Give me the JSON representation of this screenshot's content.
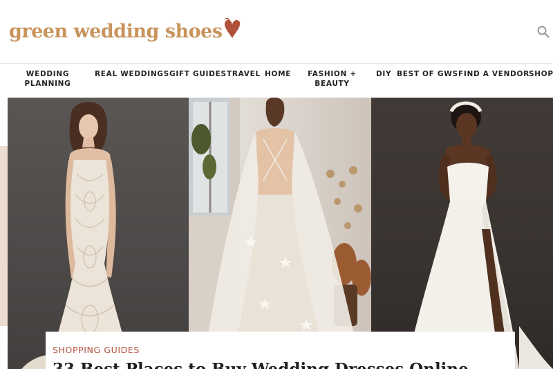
{
  "brand": {
    "logo_text": "green wedding shoes",
    "logo_color": "#c8945c",
    "heart_color": "#b1513c"
  },
  "header": {
    "search_icon": "search-icon"
  },
  "nav": {
    "items": [
      {
        "label": "WEDDING\nPLANNING"
      },
      {
        "label": "REAL WEDDINGS"
      },
      {
        "label": "GIFT GUIDES"
      },
      {
        "label": "TRAVEL"
      },
      {
        "label": "HOME"
      },
      {
        "label": "FASHION +\nBEAUTY"
      },
      {
        "label": "DIY"
      },
      {
        "label": "BEST OF GWS"
      },
      {
        "label": "FIND A VENDOR"
      },
      {
        "label": "SHOP"
      }
    ]
  },
  "hero": {
    "images": [
      {
        "subject": "lace-mermaid-gown-photo"
      },
      {
        "subject": "backless-cape-gown-photo"
      },
      {
        "subject": "strapless-slit-gown-photo"
      }
    ]
  },
  "article": {
    "category": "SHOPPING GUIDES",
    "title": "33 Best Places to Buy Wedding Dresses Online",
    "category_color": "#b1513c"
  }
}
